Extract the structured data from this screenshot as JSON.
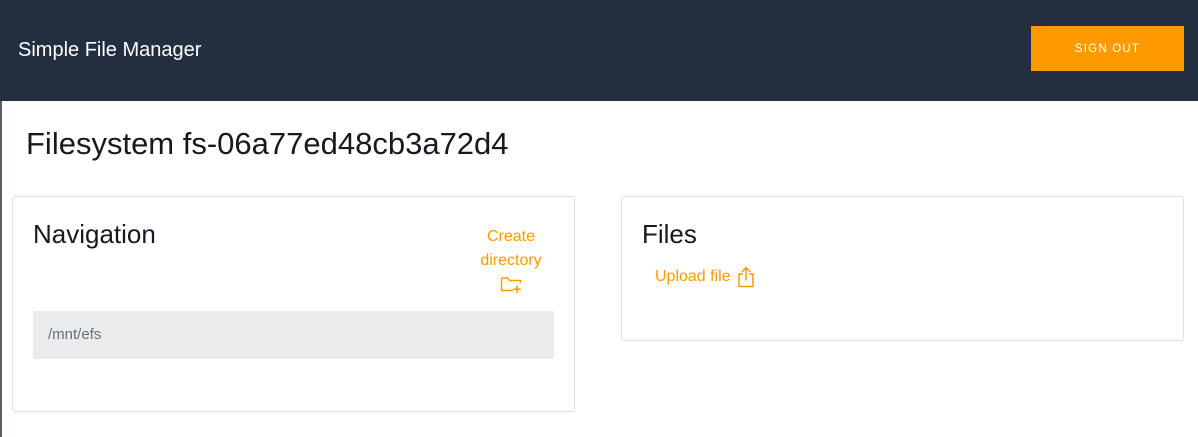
{
  "header": {
    "app_title": "Simple File Manager",
    "sign_out_label": "SIGN OUT"
  },
  "page": {
    "title": "Filesystem fs-06a77ed48cb3a72d4"
  },
  "navigation": {
    "title": "Navigation",
    "create_directory_line1": "Create",
    "create_directory_line2": "directory",
    "create_directory_icon": "folder-plus-icon",
    "current_path": "/mnt/efs"
  },
  "files": {
    "title": "Files",
    "upload_label": "Upload file",
    "upload_icon": "share-upload-icon"
  },
  "colors": {
    "header_bg": "#232f3e",
    "accent": "#ff9900",
    "path_bg": "#e9ebed"
  }
}
